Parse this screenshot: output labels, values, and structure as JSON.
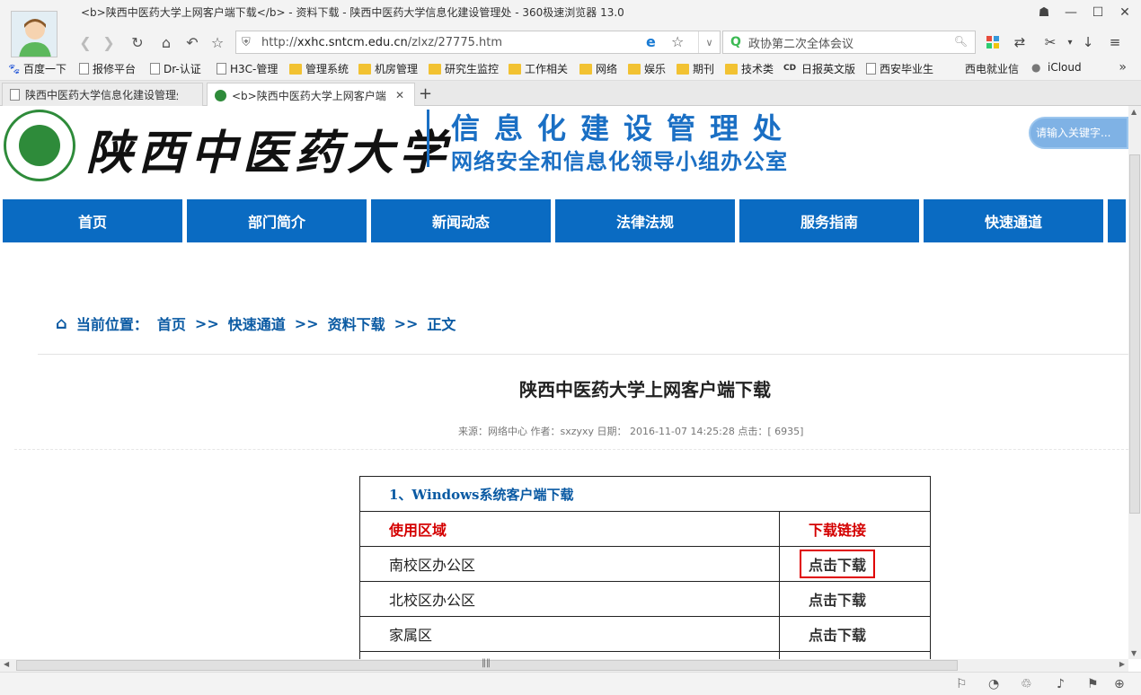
{
  "window": {
    "title": "<b>陕西中医药大学上网客户端下载</b> - 资料下载 - 陕西中医药大学信息化建设管理处 - 360极速浏览器 13.0"
  },
  "address": {
    "url_prefix": "http://",
    "url_domain": "xxhc.sntcm.edu.cn",
    "url_path": "/zlxz/27775.htm"
  },
  "search": {
    "value": "政协第二次全体会议"
  },
  "bookmarks": [
    {
      "label": "百度一下",
      "icon": "baidu-paw-icon"
    },
    {
      "label": "报修平台",
      "icon": "page-icon"
    },
    {
      "label": "Dr-认证",
      "icon": "page-icon"
    },
    {
      "label": "H3C-管理",
      "icon": "page-icon"
    },
    {
      "label": "管理系统",
      "icon": "folder-icon"
    },
    {
      "label": "机房管理",
      "icon": "folder-icon"
    },
    {
      "label": "研究生监控",
      "icon": "folder-icon"
    },
    {
      "label": "工作相关",
      "icon": "folder-icon"
    },
    {
      "label": "网络",
      "icon": "folder-icon"
    },
    {
      "label": "娱乐",
      "icon": "folder-icon"
    },
    {
      "label": "期刊",
      "icon": "folder-icon"
    },
    {
      "label": "技术类",
      "icon": "folder-icon"
    },
    {
      "label": "日报英文版",
      "icon": "cd-icon"
    },
    {
      "label": "西安毕业生",
      "icon": "page-icon"
    },
    {
      "label": "西电就业信",
      "icon": "none"
    },
    {
      "label": "iCloud",
      "icon": "apple-icon"
    }
  ],
  "tabs": [
    {
      "label": "陕西中医药大学信息化建设管理处"
    },
    {
      "label": "<b>陕西中医药大学上网客户端"
    }
  ],
  "site": {
    "school_name": "陕西中医药大学",
    "dept_name": "信息化建设管理处",
    "dept_sub": "网络安全和信息化领导小组办公室",
    "search_placeholder": "请输入关键字..."
  },
  "menu": [
    "首页",
    "部门简介",
    "新闻动态",
    "法律法规",
    "服务指南",
    "快速通道"
  ],
  "breadcrumb": {
    "label": "当前位置：",
    "items": [
      "首页",
      "快速通道",
      "资料下载",
      "正文"
    ],
    "sep": ">>"
  },
  "article": {
    "title": "陕西中医药大学上网客户端下载",
    "meta": "来源：网络中心 作者：sxzyxy    日期： 2016-11-07 14:25:28  点击：[ 6935]"
  },
  "table": {
    "section": "1、Windows系统客户端下载",
    "headers": [
      "使用区域",
      "下载链接"
    ],
    "rows": [
      [
        "南校区办公区",
        "点击下载"
      ],
      [
        "北校区办公区",
        "点击下载"
      ],
      [
        "家属区",
        "点击下载"
      ]
    ]
  },
  "colors": {
    "nav_blue": "#0a6bc2",
    "link_blue": "#0a5aa3",
    "header_red": "#d40000",
    "highlight_red": "#e00000"
  }
}
